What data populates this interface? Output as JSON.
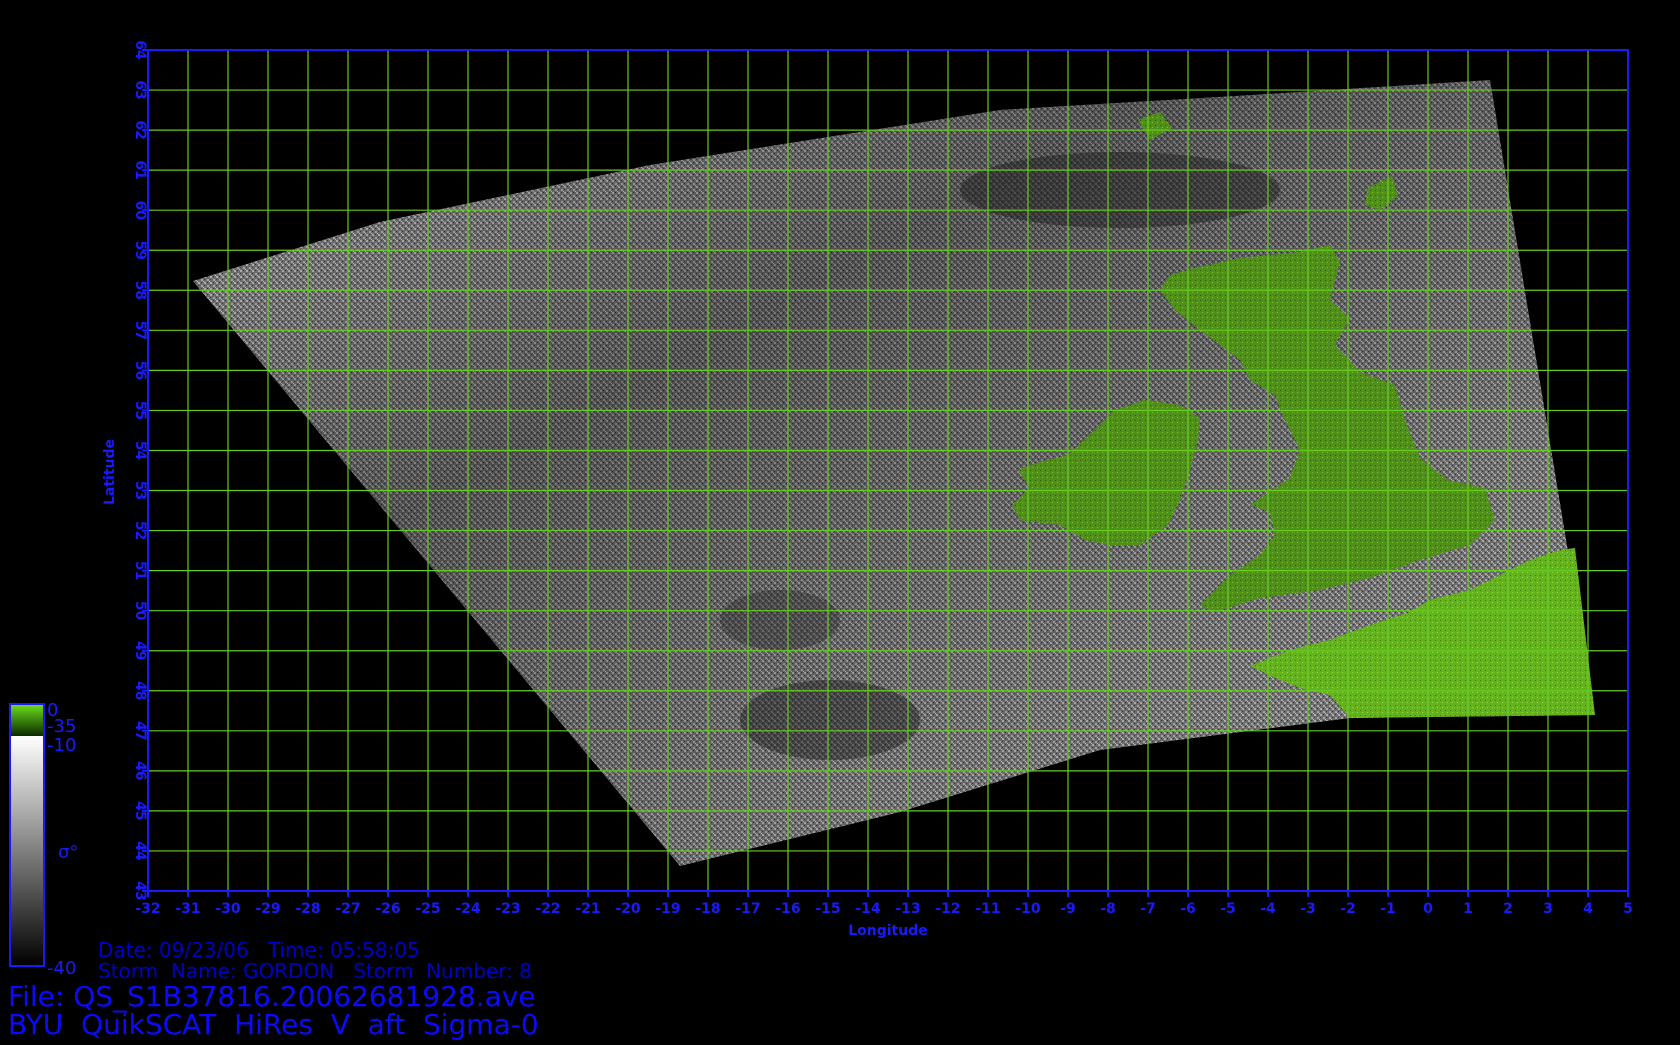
{
  "map": {
    "xlabel": "Longitude",
    "ylabel": "Latitude",
    "lon_range": [
      -32,
      5
    ],
    "lat_range": [
      43,
      64
    ],
    "lon_ticks": [
      "-32",
      "-31",
      "-30",
      "-29",
      "-28",
      "-27",
      "-26",
      "-25",
      "-24",
      "-23",
      "-22",
      "-21",
      "-20",
      "-19",
      "-18",
      "-17",
      "-16",
      "-15",
      "-14",
      "-13",
      "-12",
      "-11",
      "-10",
      "-9",
      "-8",
      "-7",
      "-6",
      "-5",
      "-4",
      "-3",
      "-2",
      "-1",
      "0",
      "1",
      "2",
      "3",
      "4",
      "5"
    ],
    "lat_ticks": [
      "43",
      "44",
      "45",
      "46",
      "47",
      "48",
      "49",
      "50",
      "51",
      "52",
      "53",
      "54",
      "55",
      "56",
      "57",
      "58",
      "59",
      "60",
      "61",
      "62",
      "63",
      "64"
    ],
    "grid": true,
    "colors": {
      "frame": "#1a1aff",
      "grid": "#66cc22",
      "land": "#4a8a18",
      "land_bright": "#6ccc1c",
      "background": "#000000"
    }
  },
  "colorbar": {
    "top_label": "0",
    "upper_label": "-35",
    "mid_label": "-10",
    "bottom_label": "-40",
    "symbol": "σ°"
  },
  "info": {
    "date_line": "Date: 09/23/06   Time: 05:58:05",
    "storm_line": "Storm  Name: GORDON   Storm  Number: 8",
    "file_line": "File: QS_S1B37816.20062681928.ave",
    "title_line": "BYU  QuikSCAT  HiRes  V  aft  Sigma-0"
  }
}
